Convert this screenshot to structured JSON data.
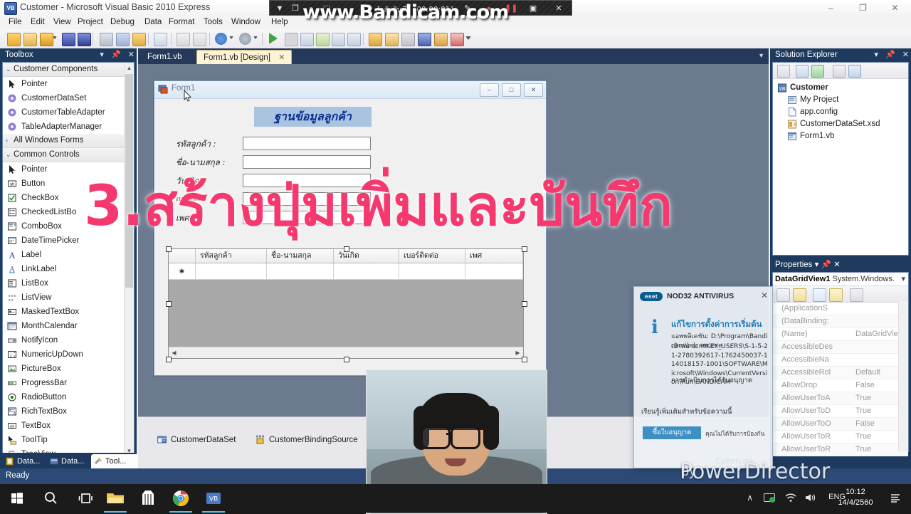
{
  "window": {
    "title": "Customer - Microsoft Visual Basic 2010 Express",
    "icon": "vb-icon",
    "minimize": "–",
    "maximize": "❐",
    "close": "✕"
  },
  "menubar": {
    "items": [
      "File",
      "Edit",
      "View",
      "Project",
      "Debug",
      "Data",
      "Format",
      "Tools",
      "Window",
      "Help"
    ]
  },
  "toolbox": {
    "title": "Toolbox",
    "dropdown_icon": "chevron-down-icon",
    "pin_icon": "pin-icon",
    "close_icon": "close-icon",
    "categories": [
      {
        "name": "Customer Components",
        "expanded": true,
        "chevron": "⌄",
        "items": [
          "Pointer",
          "CustomerDataSet",
          "CustomerTableAdapter",
          "TableAdapterManager"
        ]
      },
      {
        "name": "All Windows Forms",
        "expanded": false,
        "chevron": "›",
        "items": []
      },
      {
        "name": "Common Controls",
        "expanded": true,
        "chevron": "⌄",
        "items": [
          "Pointer",
          "Button",
          "CheckBox",
          "CheckedListBo",
          "ComboBox",
          "DateTimePicker",
          "Label",
          "LinkLabel",
          "ListBox",
          "ListView",
          "MaskedTextBox",
          "MonthCalendar",
          "NotifyIcon",
          "NumericUpDown",
          "PictureBox",
          "ProgressBar",
          "RadioButton",
          "RichTextBox",
          "TextBox",
          "ToolTip",
          "TreeView"
        ]
      }
    ]
  },
  "dock_tabs": [
    {
      "label": "Data...",
      "icon": "database-icon",
      "active": false
    },
    {
      "label": "Data...",
      "icon": "datasource-icon",
      "active": false
    },
    {
      "label": "Tool...",
      "icon": "toolbox-icon",
      "active": true
    }
  ],
  "document_tabs": [
    {
      "label": "Form1.vb",
      "active": false,
      "close": ""
    },
    {
      "label": "Form1.vb [Design]",
      "active": true,
      "close": "✕"
    }
  ],
  "form": {
    "title": "Form1",
    "icon": "form-icon",
    "min": "–",
    "max": "□",
    "close": "✕",
    "heading": "ฐานข้อมูลลูกค้า",
    "heading_bg": "#a9c3e0",
    "fields": [
      {
        "label": "รหัสลูกค้า :",
        "value": ""
      },
      {
        "label": "ชื่อ-นามสกุล :",
        "value": ""
      },
      {
        "label": "วันเกิด",
        "value": ""
      },
      {
        "label": "เบอร์ติดต่อ",
        "value": ""
      },
      {
        "label": "เพศ",
        "value": ""
      }
    ],
    "grid": {
      "columns": [
        "",
        "รหัสลูกค้า",
        "ชื่อ-นามสกุล",
        "วันเกิด",
        "เบอร์ติดต่อ",
        "เพศ"
      ],
      "new_row_marker": "✱",
      "rows": [
        [
          "",
          "",
          "",
          "",
          "",
          ""
        ]
      ],
      "scroll_left": "◀",
      "scroll_right": "▶"
    }
  },
  "component_tray": [
    {
      "label": "CustomerDataSet",
      "icon": "dataset-icon"
    },
    {
      "label": "CustomerBindingSource",
      "icon": "bindingsource-icon"
    }
  ],
  "solution_explorer": {
    "title": "Solution Explorer",
    "nodes": [
      {
        "label": "Customer",
        "icon": "project-icon",
        "level": 0,
        "selected": false
      },
      {
        "label": "My Project",
        "icon": "myproject-icon",
        "level": 1,
        "selected": false
      },
      {
        "label": "app.config",
        "icon": "config-icon",
        "level": 1,
        "selected": false
      },
      {
        "label": "CustomerDataSet.xsd",
        "icon": "xsd-icon",
        "level": 1,
        "selected": false
      },
      {
        "label": "Form1.vb",
        "icon": "form-file-icon",
        "level": 1,
        "selected": true
      }
    ]
  },
  "properties": {
    "title": "Properties",
    "object_name": "DataGridView1",
    "object_type": "System.Windows.",
    "dropdown": "▾",
    "rows": [
      {
        "key": "(ApplicationS",
        "value": ""
      },
      {
        "key": "(DataBinding:",
        "value": ""
      },
      {
        "key": "(Name)",
        "value": "DataGridView1"
      },
      {
        "key": "AccessibleDes",
        "value": ""
      },
      {
        "key": "AccessibleNa",
        "value": ""
      },
      {
        "key": "AccessibleRol",
        "value": "Default"
      },
      {
        "key": "AllowDrop",
        "value": "False"
      },
      {
        "key": "AllowUserToA",
        "value": "True"
      },
      {
        "key": "AllowUserToD",
        "value": "True"
      },
      {
        "key": "AllowUserToO",
        "value": "False"
      },
      {
        "key": "AllowUserToR",
        "value": "True"
      },
      {
        "key": "AllowUserToR",
        "value": "True"
      }
    ]
  },
  "statusbar": {
    "text": "Ready"
  },
  "bandicam": {
    "recording_text": "กำลังบันทึก [00:00:01]",
    "watermark": "www.Bandicam.com",
    "buttons": [
      "▼",
      "❐",
      "⌕",
      "⬚",
      "✎",
      "●",
      "❚❚",
      "▣",
      "✕"
    ]
  },
  "caption_overlay": {
    "text": "3.สร้างปุ่มเพิ่มและบันทึก",
    "color": "#f5386e"
  },
  "eset_toast": {
    "logo": "eset",
    "brand": "NOD32 ANTIVIRUS",
    "info_icon": "info-icon",
    "heading": "แก้ไขการตั้งค่าการเริ่มต้น",
    "line1": "แอพพลิเคชัน: D:\\Program\\Bandicam\\bdcam.exe",
    "line2": "เป้าหมาย: HKEY_USERS\\S-1-5-21-2780392617-1762450037-114018157-1001\\SOFTWARE\\Microsoft\\Windows\\CurrentVersion\\Run\\BANDICAM",
    "allowed": "การดำเนินการได้รับอนุญาต",
    "learn_more": "เรียนรู้เพิ่มเติมสำหรับข้อความนี้",
    "button": "ซื้อใบอนุญาต",
    "footer": "คุณไม่ได้รับการป้องกัน",
    "close": "✕"
  },
  "powerdirector_watermark": {
    "by": "by",
    "brand": "CyberLink",
    "product": "PowerDirector"
  },
  "taskbar": {
    "items": [
      {
        "name": "start-button",
        "icon": "windows-logo-icon"
      },
      {
        "name": "search-button",
        "icon": "search-icon"
      },
      {
        "name": "task-view-button",
        "icon": "task-view-icon"
      },
      {
        "name": "file-explorer-button",
        "icon": "folder-icon"
      },
      {
        "name": "microsoft-store-button",
        "icon": "store-icon"
      },
      {
        "name": "chrome-button",
        "icon": "chrome-icon"
      },
      {
        "name": "visual-basic-button",
        "icon": "vb-icon"
      }
    ],
    "tray": {
      "chevron": "∧",
      "eset_icon": "eset-tray-icon",
      "network_icon": "wifi-icon",
      "volume_icon": "speaker-icon",
      "language": "ENG",
      "time": "10:12",
      "date": "14/4/2560",
      "action_center": "notification-icon"
    }
  }
}
